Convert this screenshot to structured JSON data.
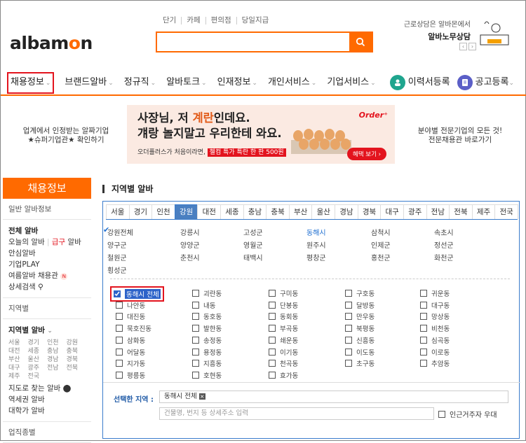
{
  "header": {
    "logo_pre": "albam",
    "logo_o": "o",
    "logo_post": "n",
    "links": [
      "단기",
      "카페",
      "편의점",
      "당일지급"
    ],
    "search_placeholder": "",
    "ad_line1": "근로상담은 알바몬에서",
    "ad_line2": "알바노무상담",
    "pager_prev": "‹",
    "pager_next": "›"
  },
  "gnb": {
    "items": [
      "채용정보",
      "브랜드알바",
      "정규직",
      "알바토크",
      "인재정보",
      "개인서비스",
      "기업서비스"
    ],
    "resume": "이력서등록",
    "post": "공고등록"
  },
  "banner": {
    "left1": "업계에서 인정받는 알짜기업",
    "left2": "★슈퍼기업관★ 확인하기",
    "right1": "분야별 전문기업의 모든 것!",
    "right2": "전문채용관 바로가기",
    "h1a": "사장님, 저 ",
    "h1b": "계란",
    "h1c": "인데요.",
    "h2": "걔랑 놀지말고 우리한테 와요.",
    "h3a": "오더플러스가 처음이라면, ",
    "h3b": "첼컴 특가 특란 한 판 500원",
    "order": "Order⁺",
    "btn": "혜택 보기 ›"
  },
  "sidebar": {
    "title": "채용정보",
    "sec1": "일반 알바정보",
    "all": "전체 알바",
    "today": "오늘의 알바",
    "urgent": "급구",
    "urgent_suffix": " 알바",
    "safe": "안심알바",
    "corp": "기업PLAY",
    "summer": "여름알바 채용관",
    "detail": "상세검색",
    "sec2": "지역별",
    "region": "지역별 알바",
    "regions": [
      "서울",
      "경기",
      "인천",
      "강원",
      "대전",
      "세종",
      "충남",
      "충북",
      "부산",
      "울산",
      "경남",
      "경북",
      "대구",
      "광주",
      "전남",
      "전북",
      "제주",
      "전국"
    ],
    "map": "지도로 찾는 알바",
    "station": "역세권 알바",
    "univ": "대학가 알바",
    "sec3": "업직종별"
  },
  "main": {
    "title": "지역별 알바",
    "tabs": [
      "서울",
      "경기",
      "인천",
      "강원",
      "대전",
      "세종",
      "충남",
      "충북",
      "부산",
      "울산",
      "경남",
      "경북",
      "대구",
      "광주",
      "전남",
      "전북",
      "제주",
      "전국"
    ],
    "active_tab": "강원",
    "cities": [
      "강원전체",
      "강릉시",
      "고성군",
      "동해시",
      "삼척시",
      "속초시",
      "양구군",
      "양양군",
      "영월군",
      "원주시",
      "인제군",
      "정선군",
      "철원군",
      "춘천시",
      "태백시",
      "평창군",
      "홍천군",
      "화천군",
      "횡성군"
    ],
    "active_city": "동해시",
    "dongs": [
      "동해시 전체",
      "괴란동",
      "구미동",
      "구호동",
      "귀운동",
      "나안동",
      "내동",
      "단봉동",
      "달방동",
      "대구동",
      "대진동",
      "동호동",
      "동회동",
      "만우동",
      "망상동",
      "묵호진동",
      "발한동",
      "부곡동",
      "북평동",
      "비천동",
      "삼화동",
      "송정동",
      "쇄운동",
      "신흥동",
      "심곡동",
      "어달동",
      "용정동",
      "이기동",
      "이도동",
      "이로동",
      "지가동",
      "지흥동",
      "천곡동",
      "초구동",
      "추암동",
      "평릉동",
      "호현동",
      "효가동"
    ],
    "selected_label": "선택한 지역 :",
    "selected_tag": "동해시 전체",
    "addr_placeholder": "건물명, 번지 등 상세주소 입력",
    "foreign": "인근거주자 우대"
  },
  "colors": {
    "brand": "#ff6a00",
    "blue": "#3b7ccc",
    "red": "#e3141e"
  }
}
